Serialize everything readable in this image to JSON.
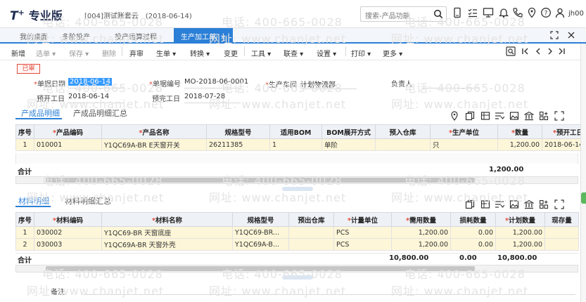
{
  "header": {
    "logo_t": "T",
    "logo_plus": "+",
    "logo_zh": "专业版",
    "account": "[004]测试账套云　(2018-06-14)",
    "search_placeholder": "搜索-产品功能",
    "user": "jh00"
  },
  "tabs": [
    {
      "label": "我的桌面"
    },
    {
      "label": "多阶投产"
    },
    {
      "label": "投产运算过程"
    },
    {
      "label": "生产加工单",
      "close": "×"
    }
  ],
  "toolbar": {
    "new": "新增",
    "choose": "选单 ▾",
    "save": "保存 ▾",
    "delete": "删除",
    "abandon": "弃审",
    "generate": "生单 ▾",
    "convert": "转换 ▾",
    "change": "变更",
    "tools": "工具 ▾",
    "query": "联查 ▾",
    "settings": "设置 ▾",
    "print": "打印 ▾",
    "more": "更多 ▾"
  },
  "status": "已审",
  "form": {
    "date_label": "单据日期",
    "date_value": "2018-06-14",
    "code_label": "单据编号",
    "code_value": "MO-2018-06-0001",
    "workshop_label": "生产车间",
    "workshop_value": "计划物流部",
    "owner_label": "负责人",
    "owner_value": "",
    "start_label": "预开工日",
    "start_value": "2018-06-14",
    "end_label": "预完工日",
    "end_value": "2018-07-28"
  },
  "product_section": {
    "tabs": [
      "产成品明细",
      "产成品明细汇总"
    ],
    "columns": [
      "序号",
      "产品编码",
      "产品名称",
      "规格型号",
      "适用BOM",
      "BOM展开方式",
      "预入仓库",
      "生产单位",
      "数量",
      "预开工日"
    ],
    "required": [
      false,
      true,
      true,
      false,
      false,
      false,
      false,
      true,
      true,
      true
    ],
    "rows": [
      [
        "1",
        "010001",
        "Y1QC69A-BR E天窗开关",
        "26211385",
        "1",
        "单阶",
        "",
        "只",
        "1,200.00",
        "2018-06-14"
      ]
    ],
    "total_label": "合计",
    "total_qty": "1,200.00"
  },
  "material_section": {
    "tabs": [
      "材料明细",
      "材料明细汇总"
    ],
    "columns": [
      "序号",
      "材料编码",
      "材料名称",
      "规格型号",
      "预出仓库",
      "计量单位",
      "需用数量",
      "损耗数量",
      "计划数量",
      "现存量"
    ],
    "required": [
      false,
      true,
      true,
      false,
      false,
      true,
      true,
      false,
      true,
      false
    ],
    "rows": [
      [
        "1",
        "030002",
        "Y1QC69-BR 天窗底座",
        "Y1QC69-BR...",
        "",
        "PCS",
        "1,200.00",
        "0.00",
        "1,200.00",
        ""
      ],
      [
        "2",
        "030003",
        "Y1QC69A-BR 天窗外壳",
        "Y1QC69A-B...",
        "",
        "PCS",
        "1,200.00",
        "0.00",
        "1,200.00",
        ""
      ]
    ],
    "total_label": "合计",
    "total_need": "10,800.00",
    "total_loss": "0.00",
    "total_plan": "10,800.00"
  },
  "remark_label": "备注",
  "watermark": {
    "phone": "电话: 400-665-0028",
    "site": "网址: www.chanjet.net"
  }
}
